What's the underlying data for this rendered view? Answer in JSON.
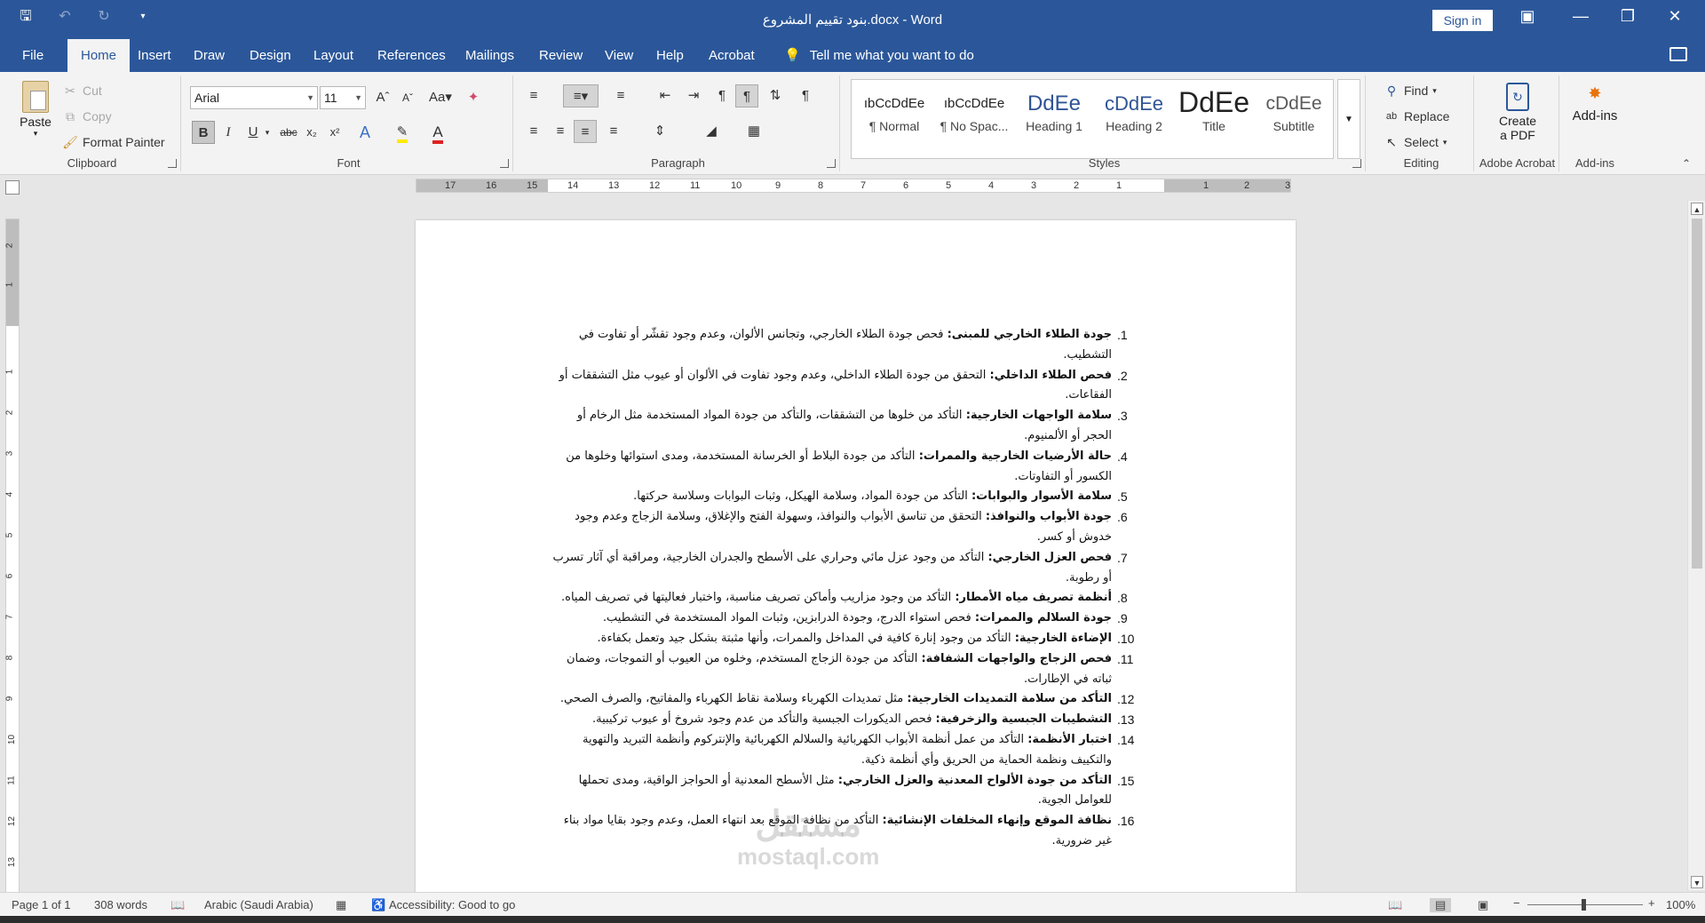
{
  "window": {
    "title": "بنود تقييم المشروع.docx  -  Word",
    "sign_in": "Sign in"
  },
  "tabs": [
    "File",
    "Home",
    "Insert",
    "Draw",
    "Design",
    "Layout",
    "References",
    "Mailings",
    "Review",
    "View",
    "Help",
    "Acrobat"
  ],
  "active_tab": "Home",
  "tell_me": "Tell me what you want to do",
  "ribbon": {
    "clipboard": {
      "label": "Clipboard",
      "paste": "Paste",
      "cut": "Cut",
      "copy": "Copy",
      "format_painter": "Format Painter"
    },
    "font": {
      "label": "Font",
      "family": "Arial",
      "size": "11"
    },
    "paragraph": {
      "label": "Paragraph"
    },
    "styles": {
      "label": "Styles",
      "items": [
        {
          "sample": "ıbCcDdEe",
          "name": "¶ Normal"
        },
        {
          "sample": "ıbCcDdEe",
          "name": "¶ No Spac..."
        },
        {
          "sample": "DdEe",
          "name": "Heading 1"
        },
        {
          "sample": "cDdEe",
          "name": "Heading 2"
        },
        {
          "sample": "DdEe",
          "name": "Title"
        },
        {
          "sample": "cDdEe",
          "name": "Subtitle"
        }
      ]
    },
    "editing": {
      "label": "Editing",
      "find": "Find",
      "replace": "Replace",
      "select": "Select"
    },
    "acrobat": {
      "label": "Adobe Acrobat",
      "create": "Create",
      "create2": "a PDF"
    },
    "addins": {
      "label": "Add-ins",
      "button": "Add-ins"
    }
  },
  "ruler": {
    "horizontal": [
      "17",
      "16",
      "15",
      "14",
      "13",
      "12",
      "11",
      "10",
      "9",
      "8",
      "7",
      "6",
      "5",
      "4",
      "3",
      "2",
      "1",
      "1",
      "2",
      "3"
    ],
    "vertical": [
      "2",
      "1",
      "1",
      "2",
      "3",
      "4",
      "5",
      "6",
      "7",
      "8",
      "9",
      "10",
      "11",
      "12",
      "13"
    ]
  },
  "document": {
    "items": [
      {
        "num": ".1",
        "title": "جودة الطلاء الخارجي للمبنى:",
        "text": " فحص جودة الطلاء الخارجي، وتجانس الألوان، وعدم وجود تقشّر أو تفاوت في التشطيب."
      },
      {
        "num": ".2",
        "title": "فحص الطلاء الداخلي:",
        "text": " التحقق من جودة الطلاء الداخلي، وعدم وجود تفاوت في الألوان أو عيوب مثل التشققات أو الفقاعات."
      },
      {
        "num": ".3",
        "title": "سلامة الواجهات الخارجية:",
        "text": " التأكد من خلوها من التشققات، والتأكد من جودة المواد المستخدمة مثل الرخام أو الحجر أو الألمنيوم."
      },
      {
        "num": ".4",
        "title": "حالة الأرضيات الخارجية والممرات:",
        "text": " التأكد من جودة البلاط أو الخرسانة المستخدمة، ومدى استوائها وخلوها من الكسور أو التفاوتات."
      },
      {
        "num": ".5",
        "title": "سلامة الأسوار والبوابات:",
        "text": " التأكد من جودة المواد، وسلامة الهيكل، وثبات البوابات وسلاسة حركتها."
      },
      {
        "num": ".6",
        "title": "جودة الأبواب والنوافذ:",
        "text": " التحقق من تناسق الأبواب والنوافذ، وسهولة الفتح والإغلاق، وسلامة الزجاج وعدم وجود خدوش أو كسر."
      },
      {
        "num": ".7",
        "title": "فحص العزل الخارجي:",
        "text": " التأكد من وجود عزل مائي وحراري على الأسطح والجدران الخارجية، ومراقبة أي آثار تسرب أو رطوبة."
      },
      {
        "num": ".8",
        "title": "أنظمة تصريف مياه الأمطار:",
        "text": " التأكد من وجود مزاريب وأماكن تصريف مناسبة، واختبار فعاليتها في تصريف المياه."
      },
      {
        "num": ".9",
        "title": "جودة السلالم والممرات:",
        "text": " فحص استواء الدرج، وجودة الدرابزين، وثبات المواد المستخدمة في التشطيب."
      },
      {
        "num": ".10",
        "title": "الإضاءة الخارجية:",
        "text": " التأكد من وجود إنارة كافية في المداخل والممرات، وأنها مثبتة بشكل جيد وتعمل بكفاءة."
      },
      {
        "num": ".11",
        "title": "فحص الزجاج والواجهات الشفافة:",
        "text": " التأكد من جودة الزجاج المستخدم، وخلوه من العيوب أو التموجات، وضمان ثباته في الإطارات."
      },
      {
        "num": ".12",
        "title": "التأكد من سلامة التمديدات الخارجية:",
        "text": " مثل تمديدات الكهرباء وسلامة نقاط الكهرباء والمفاتيح، والصرف الصحي."
      },
      {
        "num": ".13",
        "title": "التشطيبات الجبسية والزخرفية:",
        "text": " فحص الديكورات الجبسية والتأكد من عدم وجود شروخ أو عيوب تركيبية."
      },
      {
        "num": ".14",
        "title": "اختبار الأنظمة:",
        "text": " التأكد من عمل أنظمة الأبواب الكهربائية والسلالم الكهربائية والإنتركوم وأنظمة التبريد والتهوية والتكييف ونظمة الحماية من الحريق وأي أنظمة ذكية."
      },
      {
        "num": ".15",
        "title": "التأكد من جودة الألواح المعدنية والعزل الخارجي:",
        "text": " مثل الأسطح المعدنية أو الحواجز الواقية، ومدى تحملها للعوامل الجوية."
      },
      {
        "num": ".16",
        "title": "نظافة الموقع وإنهاء المخلفات الإنشائية:",
        "text": " التأكد من نظافة الموقع بعد انتهاء العمل، وعدم وجود بقايا مواد بناء غير ضرورية."
      }
    ]
  },
  "watermark": {
    "text": "مستقل",
    "sub": "mostaql.com"
  },
  "status": {
    "page": "Page 1 of 1",
    "words": "308 words",
    "language": "Arabic (Saudi Arabia)",
    "accessibility": "Accessibility: Good to go",
    "zoom": "100%"
  }
}
